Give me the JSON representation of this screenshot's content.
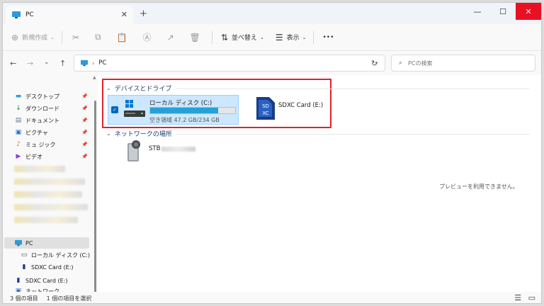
{
  "window": {
    "tab_title": "PC",
    "new_tab": "+",
    "close_tab": "✕",
    "minimize": "—",
    "maximize": "☐",
    "close": "✕",
    "accent": "#0067c0",
    "close_color": "#e81123"
  },
  "toolbar": {
    "new_label": "新規作成",
    "sort_label": "並べ替え",
    "view_label": "表示",
    "more_label": "•••"
  },
  "address": {
    "path": "PC",
    "search_placeholder": "PCの検索"
  },
  "sidebar": {
    "quick": [
      {
        "label": "デスクトップ",
        "icon": "desktop-icon"
      },
      {
        "label": "ダウンロード",
        "icon": "download-icon"
      },
      {
        "label": "ドキュメント",
        "icon": "document-icon"
      },
      {
        "label": "ピクチャ",
        "icon": "picture-icon"
      },
      {
        "label": "ミュ ジック",
        "icon": "music-icon"
      },
      {
        "label": "ビデオ",
        "icon": "video-icon"
      }
    ],
    "pc": "PC",
    "local_disk": "ローカル ディスク (C:)",
    "sd_card_child": "SDXC Card (E:)",
    "sd_card": "SDXC Card (E:)",
    "network": "ネットワーク"
  },
  "main": {
    "devices_header": "デバイスとドライブ",
    "network_header": "ネットワークの場所",
    "local_disk": {
      "name": "ローカル ディスク (C:)",
      "free": "空き領域 47.2 GB/234 GB",
      "used_fraction": 0.8
    },
    "sd_card": {
      "name": "SDXC Card (E:)"
    },
    "network_device": {
      "name": "STB"
    },
    "preview_text": "プレビューを利用できません。"
  },
  "status": {
    "items": "3 個の項目",
    "selected": "1 個の項目を選択"
  }
}
